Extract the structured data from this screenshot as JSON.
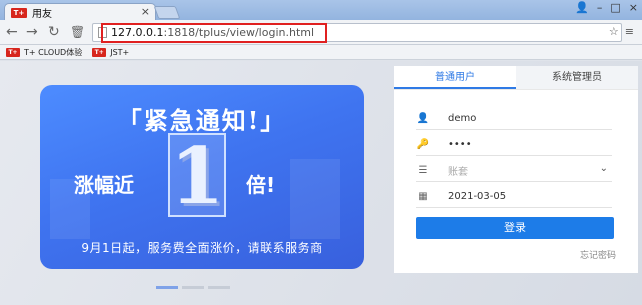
{
  "browser": {
    "tab_logo": "T+",
    "tab_title": "用友",
    "url_host": "127.0.0.1",
    "url_rest": ":1818/tplus/view/login.html",
    "bookmarks": [
      {
        "logo": "T+",
        "label": "T+ CLOUD体验"
      },
      {
        "logo": "T+",
        "label": "JST+"
      }
    ]
  },
  "banner": {
    "title": "「紧急通知!」",
    "left_text": "涨幅近",
    "big_number": "1",
    "right_text": "倍!",
    "subtitle": "9月1日起，服务费全面涨价，请联系服务商"
  },
  "login": {
    "tabs": [
      {
        "label": "普通用户",
        "active": true
      },
      {
        "label": "系统管理员",
        "active": false
      }
    ],
    "username": "demo",
    "password": "••••",
    "account_set_placeholder": "账套",
    "date": "2021-03-05",
    "submit_label": "登录",
    "forgot_label": "忘记密码"
  },
  "colors": {
    "accent": "#1d7ce8",
    "highlight_box": "#e02020"
  }
}
